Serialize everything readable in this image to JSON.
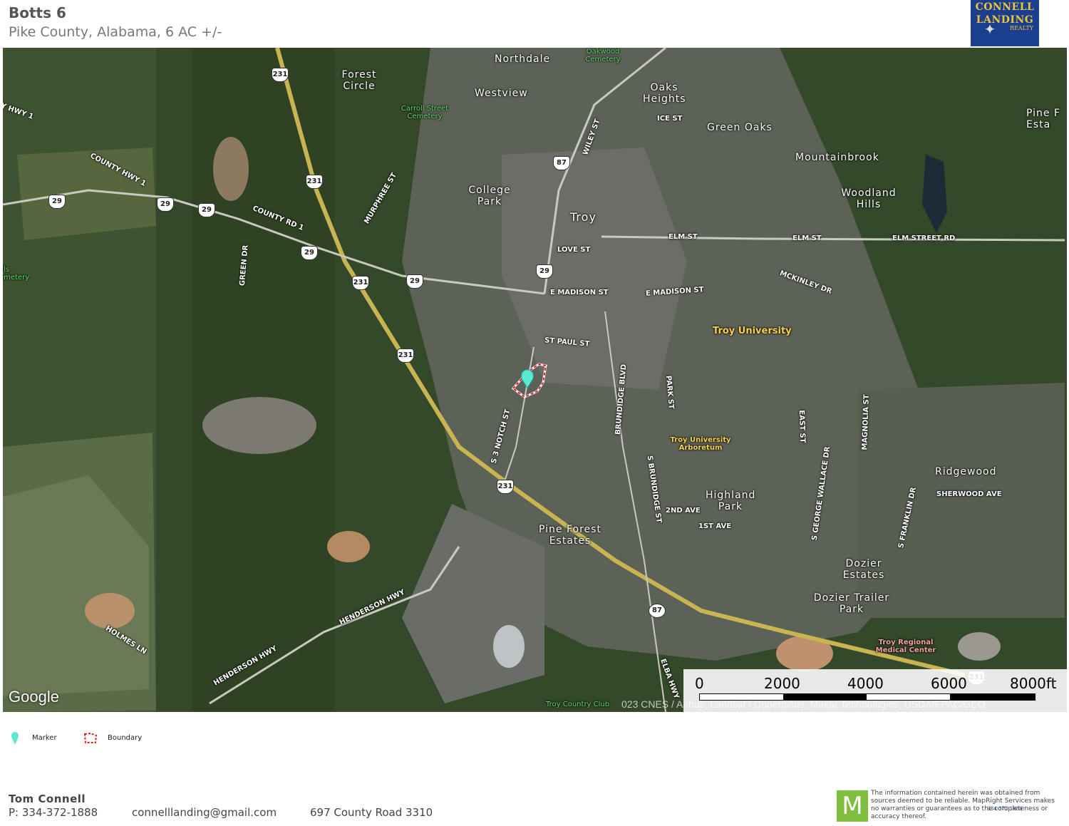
{
  "header": {
    "title": "Botts 6",
    "subtitle": "Pike County, Alabama, 6 AC +/-"
  },
  "logo": {
    "line1": "CONNELL",
    "line2": "LANDING",
    "line3": "REALTY",
    "phone": "334-372-1888"
  },
  "map": {
    "places": [
      "Northdale",
      "Forest Circle",
      "Westview",
      "Oaks Heights",
      "Green Oaks",
      "Mountainbrook",
      "College Park",
      "Troy",
      "Woodland Hills",
      "Pine Forest Estates",
      "Highland Park",
      "Ridgewood",
      "Dozier Estates",
      "Dozier Trailer Park",
      "Pine F Esta"
    ],
    "streets": [
      "ICE ST",
      "WILEY ST",
      "ELM ST",
      "ELM STREET RD",
      "LOVE ST",
      "E MADISON ST",
      "E MADISON ST",
      "MCKINLEY DR",
      "ST PAUL ST",
      "COUNTY HWY 1",
      "COUNTY RD 1",
      "MURPHREE ST",
      "GREEN DR",
      "BRUNDIDGE BLVD",
      "PARK ST",
      "S 3 NOTCH ST",
      "S BRUNDIDGE ST",
      "2ND AVE",
      "1ST AVE",
      "EAST ST",
      "MAGNOLIA ST",
      "S GEORGE WALLACE DR",
      "S FRANKLIN DR",
      "SHERWOOD AVE",
      "HENDERSON HWY",
      "HENDERSON HWY",
      "HOLMES LN",
      "ELBA HWY",
      "Y HWY 1"
    ],
    "pois": [
      "Troy University",
      "Troy University Arboretum",
      "Troy Regional Medical Center",
      "Oakwood Cemetery",
      "Carroll Street Cemetery",
      "Hills Cemetery",
      "Troy Country Club"
    ],
    "route_shields": [
      "231",
      "231",
      "231",
      "231",
      "231",
      "29",
      "29",
      "29",
      "29",
      "29",
      "29",
      "87",
      "231"
    ],
    "google_label": "Google",
    "attribution": "023 CNES / Airbus, Landsat / Copernicus, Maxar Technologies, USDA/FPAC/GEO",
    "scale": {
      "ticks": [
        "0",
        "2000",
        "4000",
        "6000",
        "8000ft"
      ]
    }
  },
  "legend": {
    "marker_label": "Marker",
    "boundary_label": "Boundary",
    "marker_color": "#5ee8d0",
    "boundary_color": "#e02020"
  },
  "footer": {
    "agent_name": "Tom  Connell",
    "phone": "P: 334-372-1888",
    "email": "connelllanding@gmail.com",
    "address": "697 County Road 3310",
    "mapright_letter": "M",
    "disclaimer": "The information contained herein was obtained from sources deemed to be reliable. MapRight Services makes no warranties or guarantees as to the completeness or accuracy thereof."
  }
}
